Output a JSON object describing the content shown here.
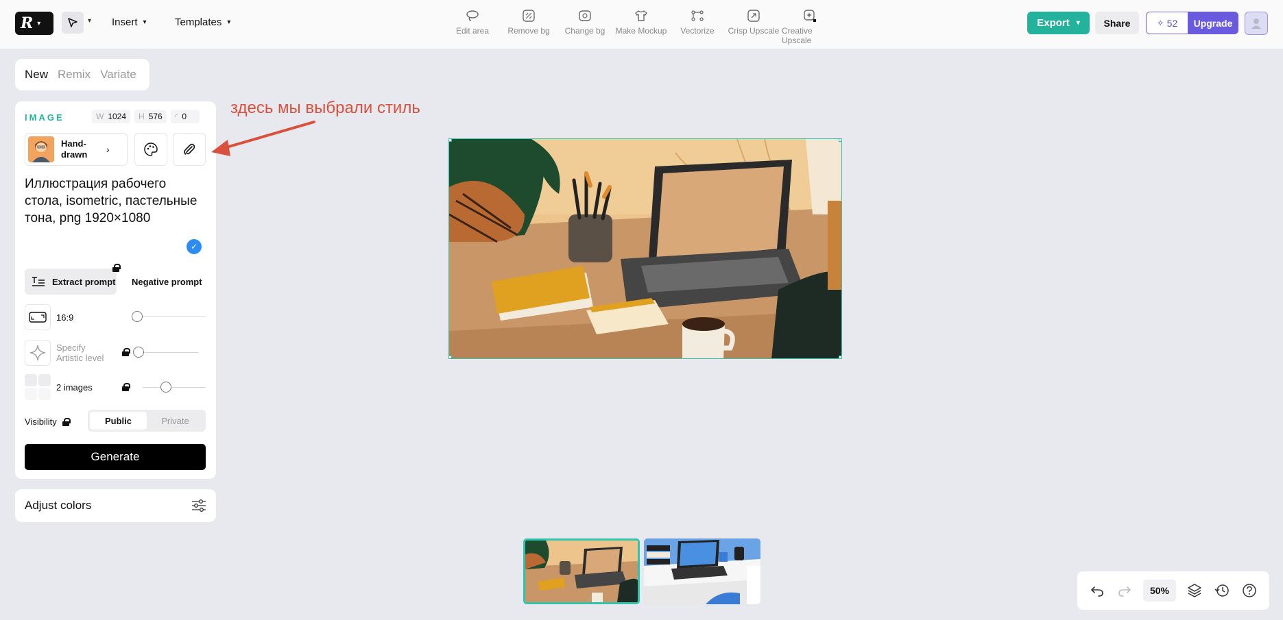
{
  "menu": {
    "insert": "Insert",
    "templates": "Templates"
  },
  "tools": [
    {
      "label": "Edit area"
    },
    {
      "label": "Remove bg"
    },
    {
      "label": "Change bg"
    },
    {
      "label": "Make Mockup"
    },
    {
      "label": "Vectorize"
    },
    {
      "label": "Crisp Upscale"
    },
    {
      "label": "Creative Upscale"
    }
  ],
  "header": {
    "export": "Export",
    "share": "Share",
    "credits": "52",
    "upgrade": "Upgrade"
  },
  "tabs": {
    "new": "New",
    "remix": "Remix",
    "variate": "Variate"
  },
  "panel": {
    "image_label": "IMAGE",
    "w_key": "W",
    "w": "1024",
    "h_key": "H",
    "h": "576",
    "r": "0",
    "style_name": "Hand-drawn",
    "prompt": "Иллюстрация рабочего стола, isometric, пастельные тона, png 1920×1080",
    "extract": "Extract prompt",
    "negative": "Negative prompt",
    "ratio": "16:9",
    "artistic": "Specify Artistic level",
    "images": "2 images",
    "visibility": "Visibility",
    "public": "Public",
    "private": "Private",
    "generate": "Generate"
  },
  "adjust": "Adjust colors",
  "annotation": "здесь мы выбрали стиль",
  "zoom": "50%",
  "colors": {
    "accent": "#23b39c",
    "selection": "#2ec4ad",
    "upgrade": "#6a5ae0",
    "annotation": "#d9503c"
  }
}
